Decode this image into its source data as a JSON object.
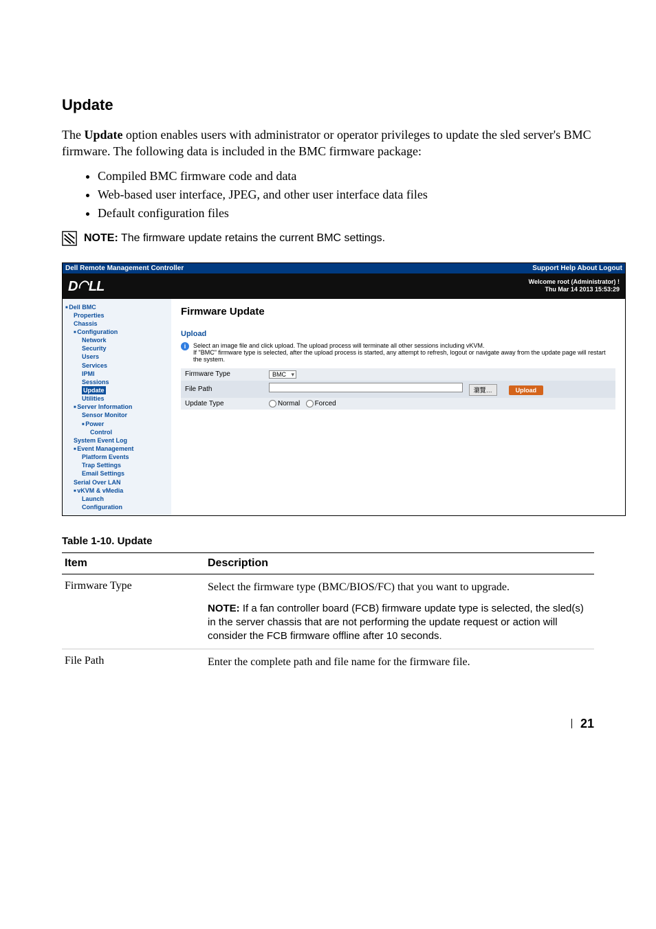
{
  "heading": "Update",
  "intro": "The Update option enables users with administrator or operator privileges to update the sled server's BMC firmware. The following data is included in the BMC firmware package:",
  "intro_bold": "Update",
  "bullets": [
    "Compiled BMC firmware code and data",
    "Web-based user interface, JPEG, and other user interface data files",
    "Default configuration files"
  ],
  "note_label": "NOTE:",
  "note_text": " The firmware update retains the current BMC settings.",
  "shot": {
    "topbar_left": "Dell Remote Management Controller",
    "topbar_right": "Support Help About Logout",
    "logo_text": "D E L L",
    "welcome_line1": "Welcome root (Administrator) !",
    "welcome_line2": "Thu Mar 14 2013 15:53:29",
    "nav": {
      "dell_bmc": "Dell BMC",
      "properties": "Properties",
      "chassis": "Chassis",
      "configuration": "Configuration",
      "network": "Network",
      "security": "Security",
      "users": "Users",
      "services": "Services",
      "ipmi": "IPMI",
      "sessions": "Sessions",
      "update": "Update",
      "utilities": "Utilities",
      "server_information": "Server Information",
      "sensor_monitor": "Sensor Monitor",
      "power": "Power",
      "control": "Control",
      "system_event_log": "System Event Log",
      "event_management": "Event Management",
      "platform_events": "Platform Events",
      "trap_settings": "Trap Settings",
      "email_settings": "Email Settings",
      "serial_over_lan": "Serial Over LAN",
      "vkvm_vmedia": "vKVM & vMedia",
      "launch": "Launch",
      "configuration2": "Configuration"
    },
    "content": {
      "title": "Firmware Update",
      "section": "Upload",
      "info1": "Select an image file and click upload. The upload process will terminate all other sessions including vKVM.",
      "info2": "If \"BMC\" firmware type is selected, after the upload process is started, any attempt to refresh, logout or navigate away from the update page will restart the system.",
      "row1_label": "Firmware Type",
      "row1_value": "BMC",
      "row2_label": "File Path",
      "browse": "瀏覽…",
      "upload_btn": "Upload",
      "row3_label": "Update Type",
      "radio_normal": "Normal",
      "radio_forced": "Forced"
    }
  },
  "table_caption": "Table 1-10.    Update",
  "table": {
    "h1": "Item",
    "h2": "Description",
    "r1c1": "Firmware Type",
    "r1c2": "Select the firmware type (BMC/BIOS/FC) that you want to upgrade.",
    "r1note_label": "NOTE:",
    "r1note_text": " If a fan controller board (FCB) firmware update type is selected, the sled(s) in the server chassis that are not performing the update request or action will consider the FCB firmware offline after 10 seconds.",
    "r2c1": "File Path",
    "r2c2": "Enter the complete path and file name for the firmware file."
  },
  "page_number": "21"
}
